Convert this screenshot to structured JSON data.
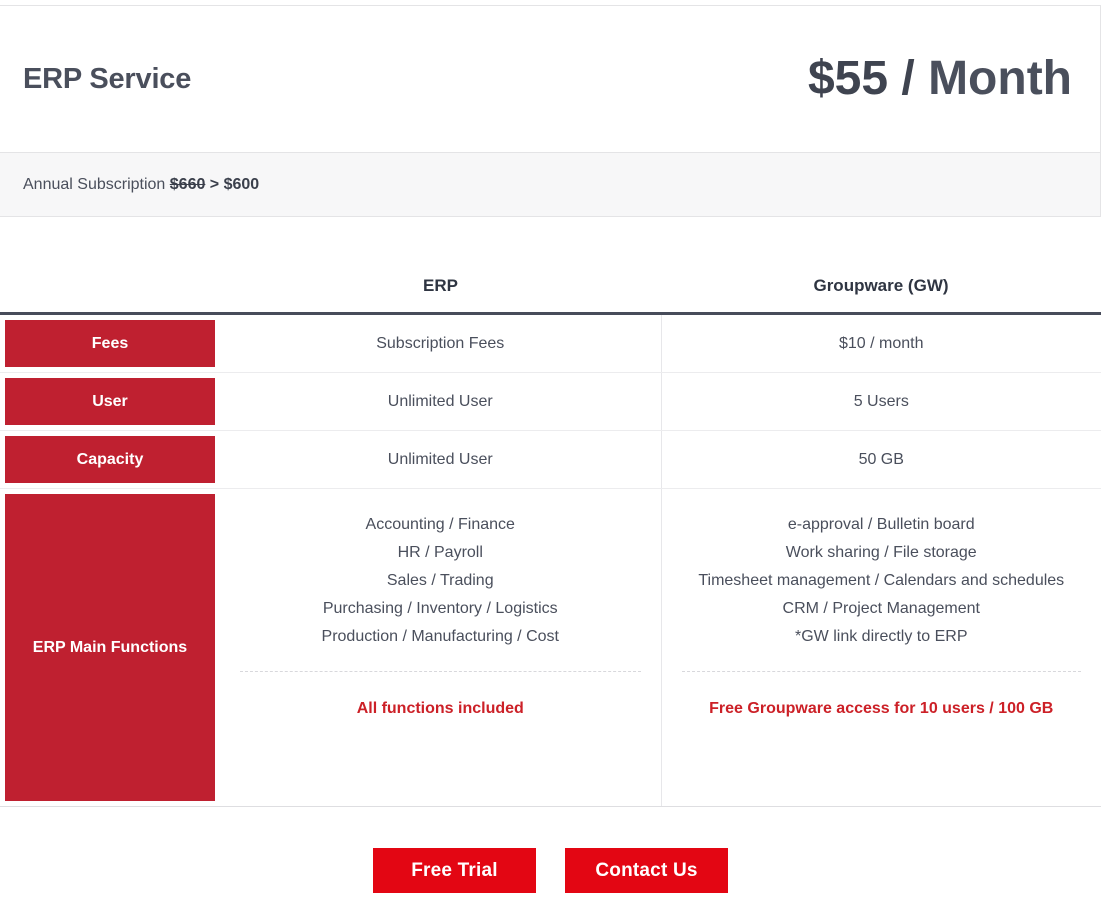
{
  "header": {
    "service_title": "ERP Service",
    "price_amount": "$55",
    "price_slash": " / ",
    "price_period": "Month"
  },
  "annual": {
    "label": "Annual Subscription ",
    "old_price": "$660",
    "arrow": " > ",
    "new_price": "$600"
  },
  "table": {
    "columns": {
      "erp": "ERP",
      "groupware": "Groupware (GW)"
    },
    "rows": [
      {
        "label": "Fees",
        "erp": "Subscription Fees",
        "gw": "$10 / month"
      },
      {
        "label": "User",
        "erp": "Unlimited User",
        "gw": "5 Users"
      },
      {
        "label": "Capacity",
        "erp": "Unlimited User",
        "gw": "50 GB"
      }
    ],
    "functions": {
      "label": "ERP Main Functions",
      "erp_items": [
        "Accounting / Finance",
        "HR / Payroll",
        "Sales / Trading",
        "Purchasing / Inventory / Logistics",
        "Production / Manufacturing / Cost"
      ],
      "gw_items": [
        "e-approval / Bulletin board",
        "Work sharing / File storage",
        "Timesheet management / Calendars and schedules",
        "CRM / Project Management",
        "*GW link directly to ERP"
      ],
      "erp_note": "All functions included",
      "gw_note": "Free Groupware access for 10 users / 100 GB"
    }
  },
  "cta": {
    "free_trial": "Free Trial",
    "contact_us": "Contact Us"
  },
  "colors": {
    "brand_red": "#bf2030",
    "button_red": "#e30613",
    "note_red": "#cc2027",
    "text_dark": "#4a4f5c",
    "header_rule": "#474c5a"
  }
}
